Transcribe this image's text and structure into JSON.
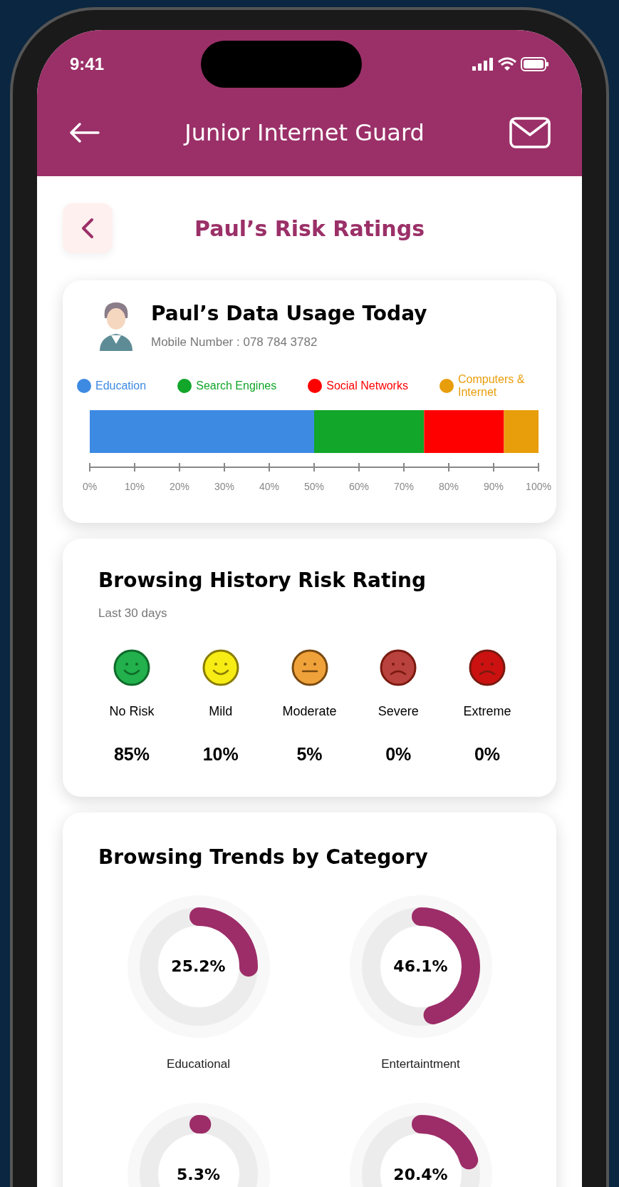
{
  "status_bar": {
    "time": "9:41"
  },
  "header": {
    "title": "Junior Internet Guard"
  },
  "page": {
    "title": "Paul’s Risk Ratings"
  },
  "usage_card": {
    "title": "Paul’s Data Usage Today",
    "subtitle": "Mobile Number : 078 784 3782",
    "chart_data": {
      "type": "bar",
      "orientation": "horizontal",
      "stacked": true,
      "series": [
        {
          "name": "Education",
          "color": "#3d8ae3",
          "values": [
            50
          ]
        },
        {
          "name": "Search Engines",
          "color": "#12a62a",
          "values": [
            24.5
          ]
        },
        {
          "name": "Social Networks",
          "color": "#ff0000",
          "values": [
            17.8
          ]
        },
        {
          "name": "Computers & Internet",
          "color": "#e89d0a",
          "values": [
            7.7
          ]
        }
      ],
      "xlim": [
        0,
        100
      ],
      "legend": true,
      "xticks": [
        {
          "value": 0,
          "label": "0%"
        },
        {
          "value": 10,
          "label": "10%"
        },
        {
          "value": 20,
          "label": "20%"
        },
        {
          "value": 30,
          "label": "30%"
        },
        {
          "value": 40,
          "label": "40%"
        },
        {
          "value": 50,
          "label": "50%"
        },
        {
          "value": 60,
          "label": "60%"
        },
        {
          "value": 70,
          "label": "70%"
        },
        {
          "value": 80,
          "label": "80%"
        },
        {
          "value": 90,
          "label": "90%"
        },
        {
          "value": 100,
          "label": "100%"
        }
      ]
    }
  },
  "risk_card": {
    "title": "Browsing History Risk Rating",
    "subtitle": "Last 30 days",
    "ratings": [
      {
        "kind": "happy",
        "label": "No Risk",
        "value": "85%",
        "color": "#22b14c"
      },
      {
        "kind": "happy",
        "label": "Mild",
        "value": "10%",
        "color": "#f7ec14"
      },
      {
        "kind": "neutral",
        "label": "Moderate",
        "value": "5%",
        "color": "#f0a23a"
      },
      {
        "kind": "sad",
        "label": "Severe",
        "value": "0%",
        "color": "#b9423e"
      },
      {
        "kind": "sad",
        "label": "Extreme",
        "value": "0%",
        "color": "#cc1111"
      }
    ]
  },
  "trends_card": {
    "title": "Browsing Trends by Category",
    "categories": [
      {
        "value": "25.2%",
        "level": 0.252,
        "label": "Educational"
      },
      {
        "value": "46.1%",
        "level": 0.461,
        "label": "Entertaintment"
      },
      {
        "value": "5.3%",
        "level": 0.01
      },
      {
        "value": "20.4%",
        "level": 0.204
      }
    ]
  }
}
